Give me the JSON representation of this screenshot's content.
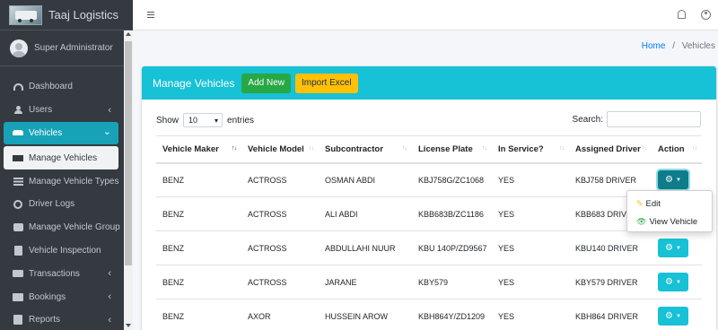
{
  "brand": {
    "name": "Taaj Logistics"
  },
  "user": {
    "name": "Super Administrator"
  },
  "sidebar": {
    "items": [
      {
        "label": "Dashboard",
        "icon": "dashboard-icon"
      },
      {
        "label": "Users",
        "icon": "users-icon",
        "chevron": "‹"
      },
      {
        "label": "Vehicles",
        "icon": "car-icon",
        "chevron": "⌄"
      },
      {
        "label": "Manage Vehicles",
        "icon": "truck-icon"
      },
      {
        "label": "Manage Vehicle Types",
        "icon": "list-icon"
      },
      {
        "label": "Driver Logs",
        "icon": "history-icon"
      },
      {
        "label": "Manage Vehicle Group",
        "icon": "briefcase-icon"
      },
      {
        "label": "Vehicle Inspection",
        "icon": "clipboard-icon"
      },
      {
        "label": "Transactions",
        "icon": "money-icon",
        "chevron": "‹"
      },
      {
        "label": "Bookings",
        "icon": "id-card-icon",
        "chevron": "‹"
      },
      {
        "label": "Reports",
        "icon": "book-icon",
        "chevron": "‹"
      }
    ]
  },
  "breadcrumb": {
    "home": "Home",
    "separator": "/",
    "current": "Vehicles"
  },
  "card": {
    "title": "Manage Vehicles",
    "add_label": "Add New",
    "import_label": "Import Excel"
  },
  "controls": {
    "show_label": "Show",
    "entries_value": "10",
    "entries_label": "entries",
    "search_label": "Search:"
  },
  "table": {
    "headers": [
      "Vehicle Maker",
      "Vehicle Model",
      "Subcontractor",
      "License Plate",
      "In Service?",
      "Assigned Driver",
      "Action"
    ],
    "rows": [
      [
        "BENZ",
        "ACTROSS",
        "OSMAN ABDI",
        "KBJ758G/ZC1068",
        "YES",
        "KBJ758 DRIVER"
      ],
      [
        "BENZ",
        "ACTROSS",
        "ALI ABDI",
        "KBB683B/ZC1186",
        "YES",
        "KBB683 DRIVER"
      ],
      [
        "BENZ",
        "ACTROSS",
        "ABDULLAHI NUUR",
        "KBU 140P/ZD9567",
        "YES",
        "KBU140 DRIVER"
      ],
      [
        "BENZ",
        "ACTROSS",
        "JARANE",
        "KBY579",
        "YES",
        "KBY579 DRIVER"
      ],
      [
        "BENZ",
        "AXOR",
        "HUSSEIN AROW",
        "KBH864Y/ZD1209",
        "YES",
        "KBH864 DRIVER"
      ]
    ]
  },
  "action_menu": {
    "edit_label": "Edit",
    "view_label": "View Vehicle"
  },
  "colors": {
    "sidebar": "#343a40",
    "accent": "#17c1d6",
    "success": "#28a745",
    "warning": "#ffc107"
  }
}
